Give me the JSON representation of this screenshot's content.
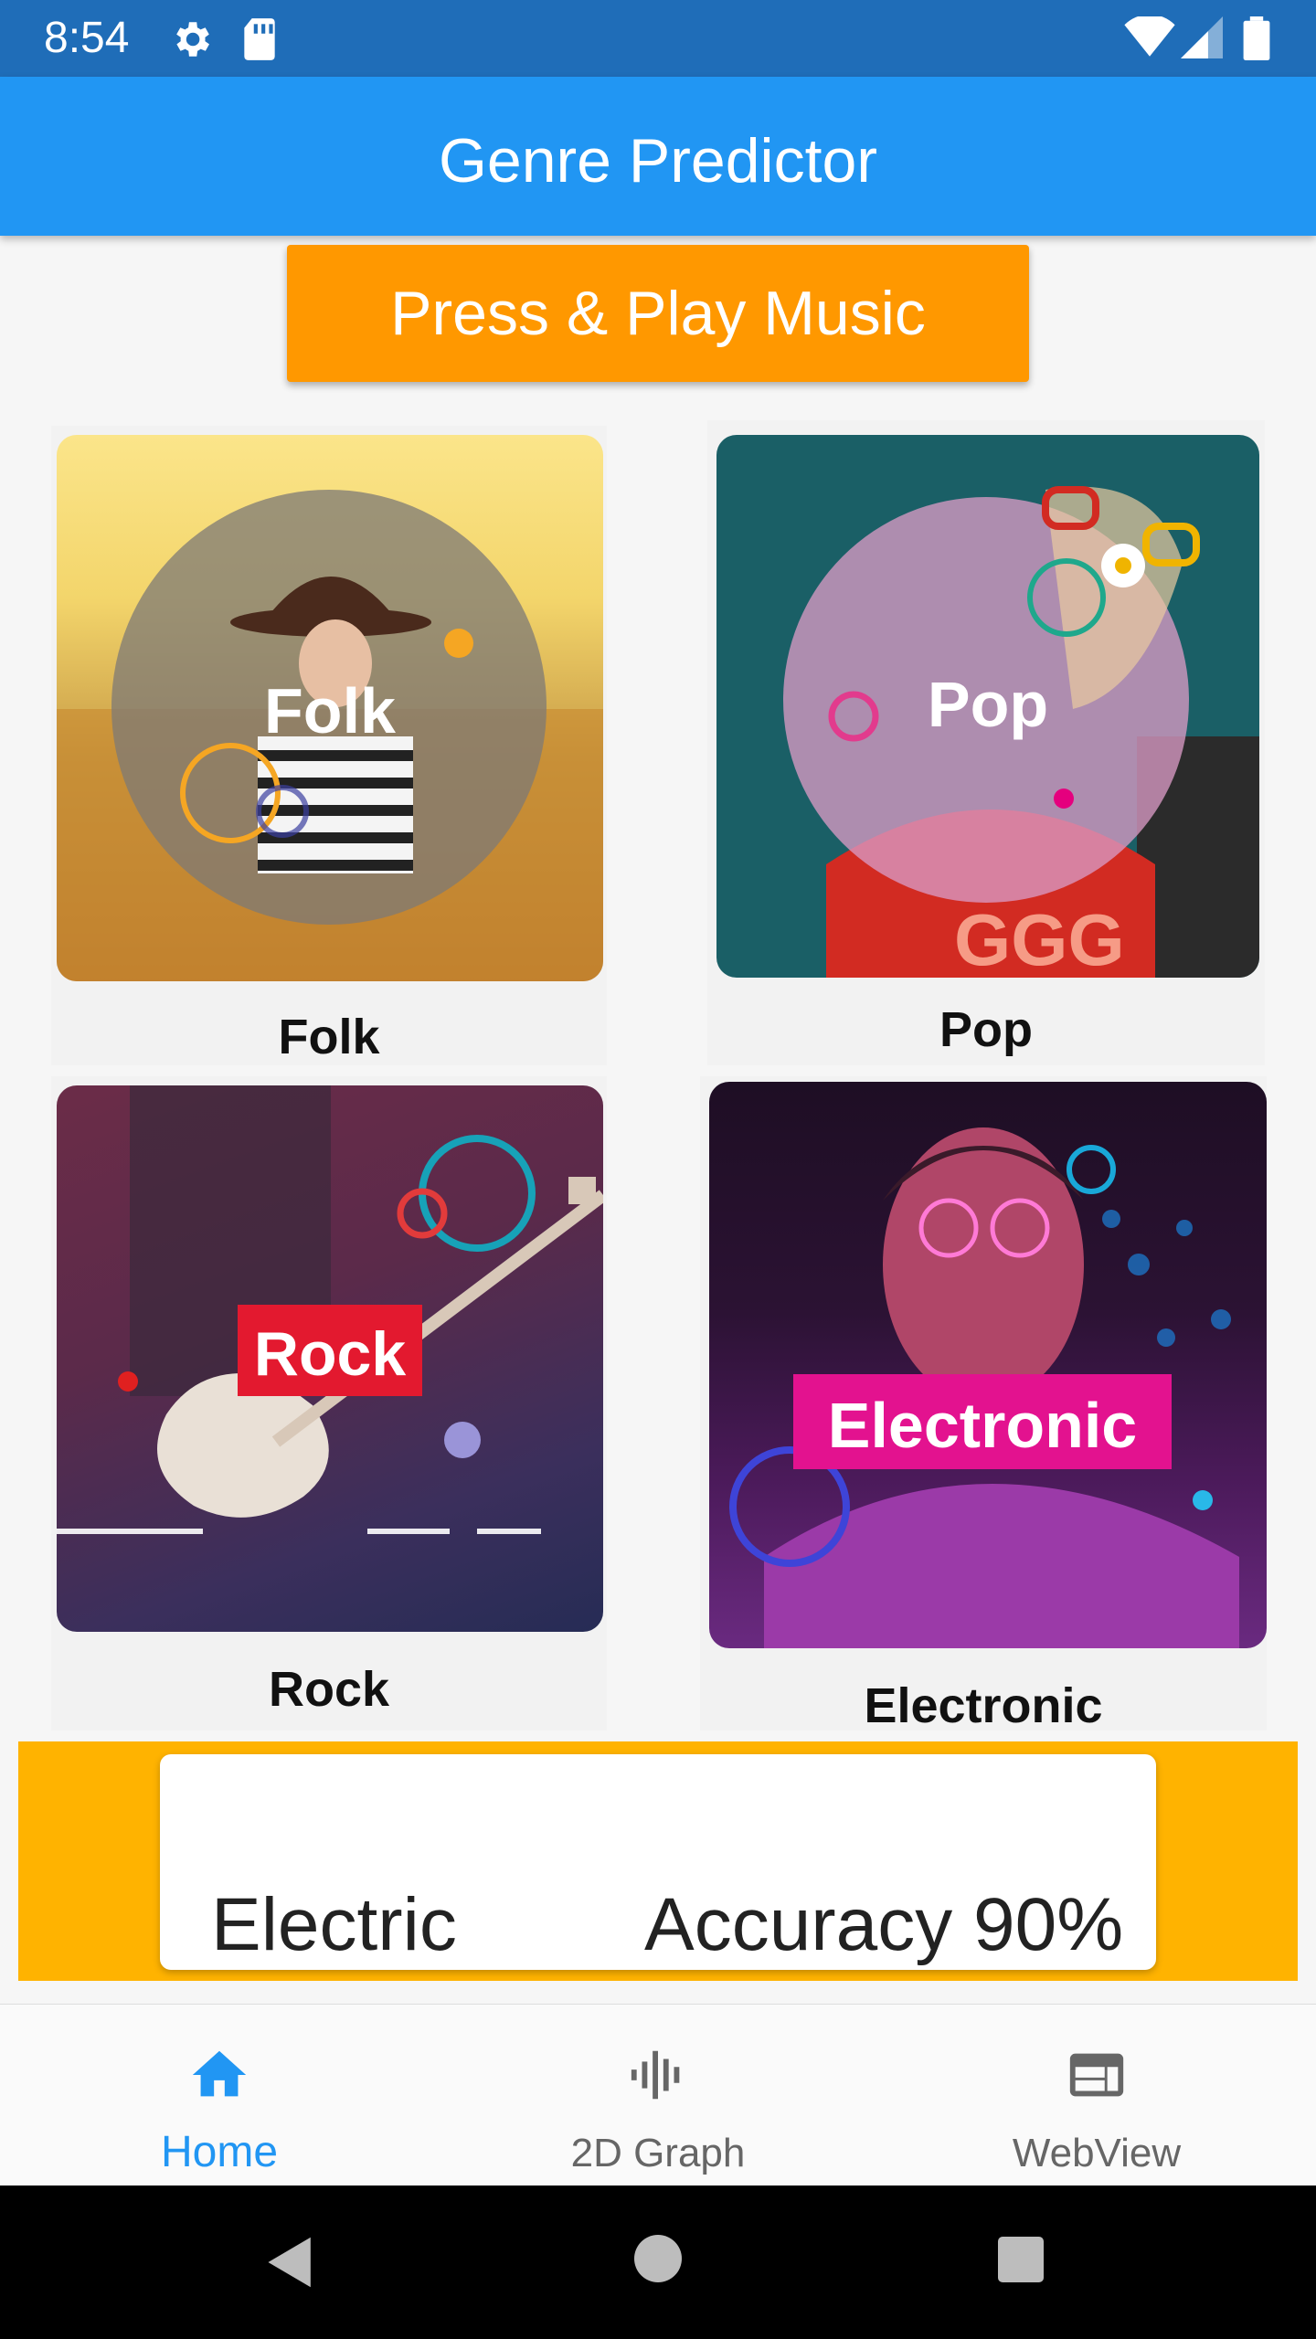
{
  "status_bar": {
    "time": "8:54",
    "icons": [
      "settings-icon",
      "sd-card-icon",
      "wifi-icon",
      "signal-icon",
      "battery-icon"
    ]
  },
  "app_bar": {
    "title": "Genre Predictor"
  },
  "play_button": {
    "label": "Press & Play Music",
    "color": "#ff9800"
  },
  "genres": [
    {
      "name": "Folk",
      "image_label": "Folk"
    },
    {
      "name": "Pop",
      "image_label": "Pop"
    },
    {
      "name": "Rock",
      "image_label": "Rock"
    },
    {
      "name": "Electronic",
      "image_label": "Electronic"
    }
  ],
  "result": {
    "genre": "Electric",
    "accuracy": "Accuracy 90%",
    "panel_color": "#ffb300"
  },
  "bottom_nav": {
    "items": [
      {
        "label": "Home",
        "icon": "home-icon",
        "active": true
      },
      {
        "label": "2D Graph",
        "icon": "graph-icon",
        "active": false
      },
      {
        "label": "WebView",
        "icon": "webview-icon",
        "active": false
      }
    ],
    "active_color": "#2196f3",
    "inactive_color": "#666666"
  },
  "system_nav": {
    "icons": [
      "back-icon",
      "home-circle-icon",
      "recents-icon"
    ]
  }
}
